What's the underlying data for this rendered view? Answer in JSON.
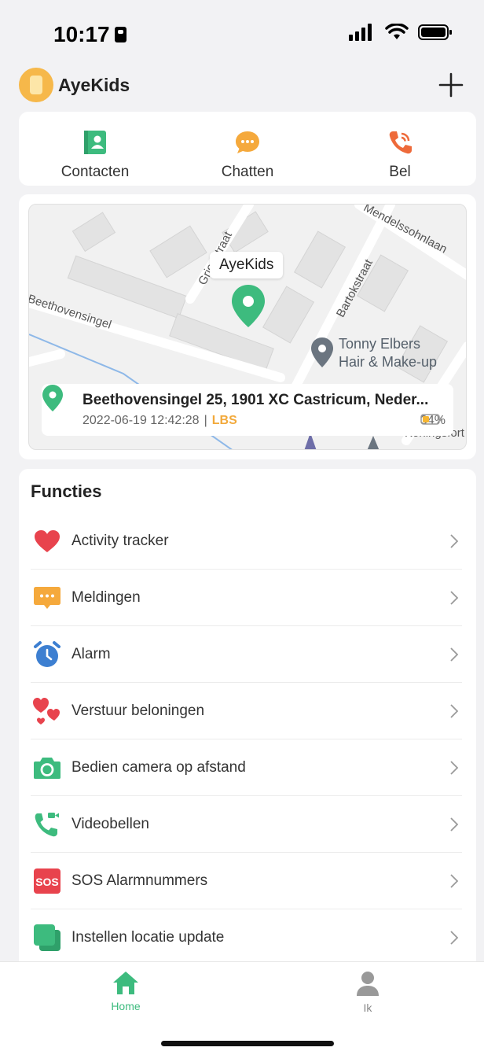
{
  "status_bar": {
    "time": "10:17"
  },
  "app": {
    "name": "AyeKids",
    "add_icon": "plus-icon"
  },
  "quick_actions": [
    {
      "label": "Contacten",
      "icon": "contacts-icon",
      "color": "#3dbb7e"
    },
    {
      "label": "Chatten",
      "icon": "chat-icon",
      "color": "#f5a93c"
    },
    {
      "label": "Bel",
      "icon": "phone-icon",
      "color": "#ee6a3a"
    }
  ],
  "map": {
    "device_tag": "AyeKids",
    "poi_line1": "Tonny Elbers",
    "poi_line2": "Hair & Make-up",
    "streets": [
      "Griegstraat",
      "Beethovensingel",
      "Bartokstraat",
      "Mendelssohnlaan",
      "Koningsfort"
    ],
    "address": "Beethovensingel 25, 1901 XC Castricum, Neder...",
    "timestamp": "2022-06-19 12:42:28",
    "separator": "|",
    "source": "LBS",
    "battery": "34%"
  },
  "functions": {
    "title": "Functies",
    "items": [
      {
        "label": "Activity tracker",
        "icon": "heart-icon"
      },
      {
        "label": "Meldingen",
        "icon": "message-icon"
      },
      {
        "label": "Alarm",
        "icon": "alarm-clock-icon"
      },
      {
        "label": "Verstuur beloningen",
        "icon": "hearts-reward-icon"
      },
      {
        "label": "Bedien camera op afstand",
        "icon": "camera-icon"
      },
      {
        "label": "Videobellen",
        "icon": "video-call-icon"
      },
      {
        "label": "SOS Alarmnummers",
        "icon": "sos-icon",
        "icon_text": "SOS"
      },
      {
        "label": "Instellen locatie update",
        "icon": "location-update-icon"
      }
    ]
  },
  "tabbar": {
    "tabs": [
      {
        "label": "Home",
        "icon": "home-icon",
        "active": true
      },
      {
        "label": "Ik",
        "icon": "person-icon",
        "active": false
      }
    ]
  },
  "colors": {
    "accent": "#3dbb7e",
    "lbs": "#f2a93b"
  }
}
